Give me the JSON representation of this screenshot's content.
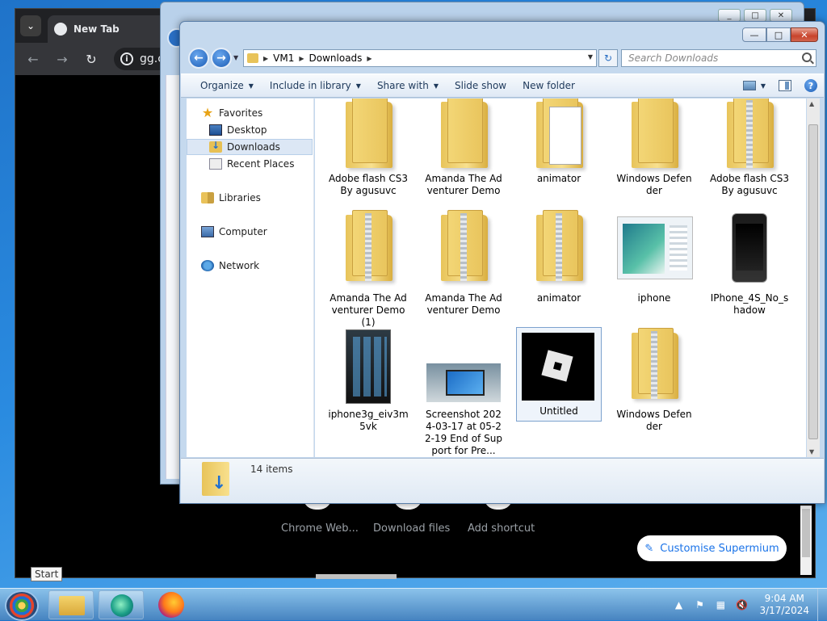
{
  "browser": {
    "tab_title": "New Tab",
    "url": "gg.c",
    "shortcuts": [
      "Chrome Web...",
      "Download files",
      "Add shortcut"
    ],
    "customise_label": "Customise Supermium"
  },
  "bg_window": {
    "controls": [
      "_",
      "□",
      "✕"
    ]
  },
  "explorer": {
    "controls": {
      "min": "—",
      "max": "□",
      "close": "✕"
    },
    "breadcrumb": [
      "VM1",
      "Downloads"
    ],
    "search_placeholder": "Search Downloads",
    "commands": [
      "Organize",
      "Include in library",
      "Share with",
      "Slide show",
      "New folder"
    ],
    "help": "?",
    "nav": {
      "favorites": "Favorites",
      "desktop": "Desktop",
      "downloads": "Downloads",
      "recent": "Recent Places",
      "libraries": "Libraries",
      "computer": "Computer",
      "network": "Network"
    },
    "files": [
      {
        "label": "Adobe flash CS3 By agusuvc",
        "kind": "folder"
      },
      {
        "label": "Amanda The Adventurer Demo",
        "kind": "folder"
      },
      {
        "label": "animator",
        "kind": "folder-doc"
      },
      {
        "label": "Windows Defender",
        "kind": "folder"
      },
      {
        "label": "Adobe flash CS3 By agusuvc",
        "kind": "zip"
      },
      {
        "label": "Amanda The Adventurer Demo (1)",
        "kind": "zip"
      },
      {
        "label": "Amanda The Adventurer Demo",
        "kind": "zip"
      },
      {
        "label": "animator",
        "kind": "zip"
      },
      {
        "label": "iphone",
        "kind": "image"
      },
      {
        "label": "IPhone_4S_No_shadow",
        "kind": "image"
      },
      {
        "label": "iphone3g_eiv3m5vk",
        "kind": "image"
      },
      {
        "label": "Screenshot 2024-03-17 at 05-22-19 End of Support for Pre...",
        "kind": "image"
      },
      {
        "label": "Untitled",
        "kind": "image"
      },
      {
        "label": "Windows Defender",
        "kind": "zip"
      }
    ],
    "status": "14 items"
  },
  "taskbar": {
    "tooltip": "Start",
    "time": "9:04 AM",
    "date": "3/17/2024"
  }
}
